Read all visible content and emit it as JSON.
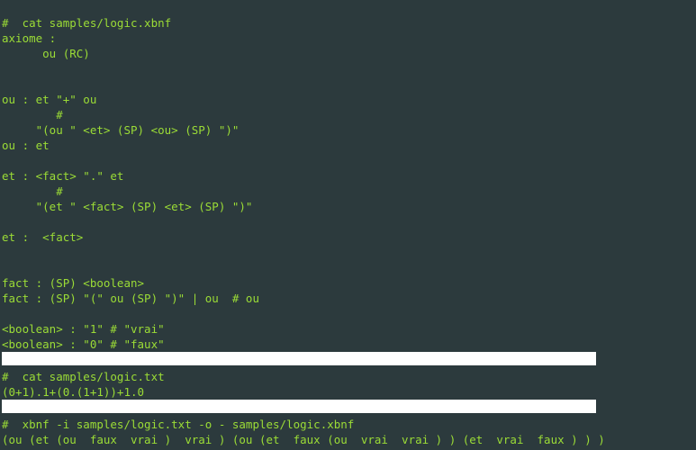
{
  "lines": [
    {
      "text": "#  cat samples/logic.xbnf",
      "cls": ""
    },
    {
      "text": "axiome :",
      "cls": ""
    },
    {
      "text": "      ou (RC)",
      "cls": ""
    },
    {
      "text": "",
      "cls": ""
    },
    {
      "text": "",
      "cls": ""
    },
    {
      "text": "ou : et \"+\" ou",
      "cls": ""
    },
    {
      "text": "        #",
      "cls": ""
    },
    {
      "text": "     \"(ou \" <et> (SP) <ou> (SP) \")\"",
      "cls": ""
    },
    {
      "text": "ou : et",
      "cls": ""
    },
    {
      "text": "",
      "cls": ""
    },
    {
      "text": "et : <fact> \".\" et",
      "cls": ""
    },
    {
      "text": "        #",
      "cls": ""
    },
    {
      "text": "     \"(et \" <fact> (SP) <et> (SP) \")\"",
      "cls": ""
    },
    {
      "text": "",
      "cls": ""
    },
    {
      "text": "et :  <fact>",
      "cls": ""
    },
    {
      "text": "",
      "cls": ""
    },
    {
      "text": "",
      "cls": ""
    },
    {
      "text": "fact : (SP) <boolean>",
      "cls": ""
    },
    {
      "text": "fact : (SP) \"(\" ou (SP) \")\" | ou  # ou",
      "cls": ""
    },
    {
      "text": "",
      "cls": ""
    },
    {
      "text": "<boolean> : \"1\" # \"vrai\"",
      "cls": ""
    },
    {
      "text": "<boolean> : \"0\" # \"faux\"",
      "cls": ""
    },
    {
      "text": "",
      "cls": "inv"
    },
    {
      "text": "#  cat samples/logic.txt",
      "cls": ""
    },
    {
      "text": "(0+1).1+(0.(1+1))+1.0",
      "cls": ""
    },
    {
      "text": "",
      "cls": "inv"
    },
    {
      "text": "#  xbnf -i samples/logic.txt -o - samples/logic.xbnf",
      "cls": ""
    },
    {
      "text": "(ou (et (ou  faux  vrai )  vrai ) (ou (et  faux (ou  vrai  vrai ) ) (et  vrai  faux ) ) )",
      "cls": ""
    }
  ]
}
